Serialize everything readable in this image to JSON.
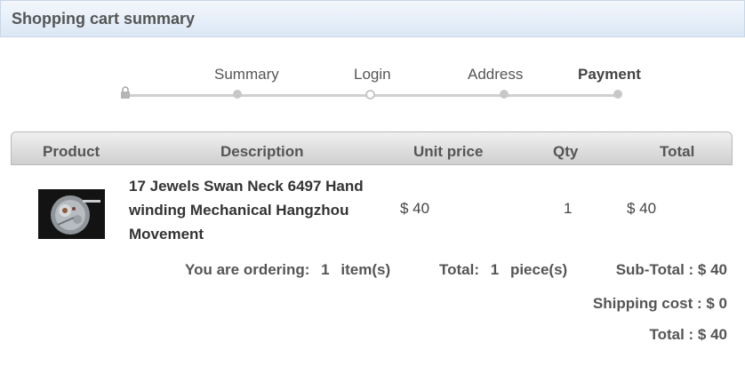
{
  "header": {
    "title": "Shopping cart summary"
  },
  "steps": [
    {
      "label": "Summary"
    },
    {
      "label": "Login"
    },
    {
      "label": "Address"
    },
    {
      "label": "Payment"
    }
  ],
  "table": {
    "headers": [
      "Product",
      "Description",
      "Unit price",
      "Qty",
      "Total"
    ],
    "rows": [
      {
        "description": "17 Jewels Swan Neck 6497 Hand winding Mechanical Hangzhou Movement",
        "unit_price": "$ 40",
        "qty": "1",
        "total": "$ 40"
      }
    ]
  },
  "summary": {
    "ordering_label": "You are ordering:",
    "ordering_count": "1",
    "ordering_unit": "item(s)",
    "total_label": "Total:",
    "total_count": "1",
    "total_unit": "piece(s)",
    "subtotal": "Sub-Total : $ 40",
    "shipping": "Shipping cost : $ 0",
    "grand_total": "Total : $ 40"
  }
}
